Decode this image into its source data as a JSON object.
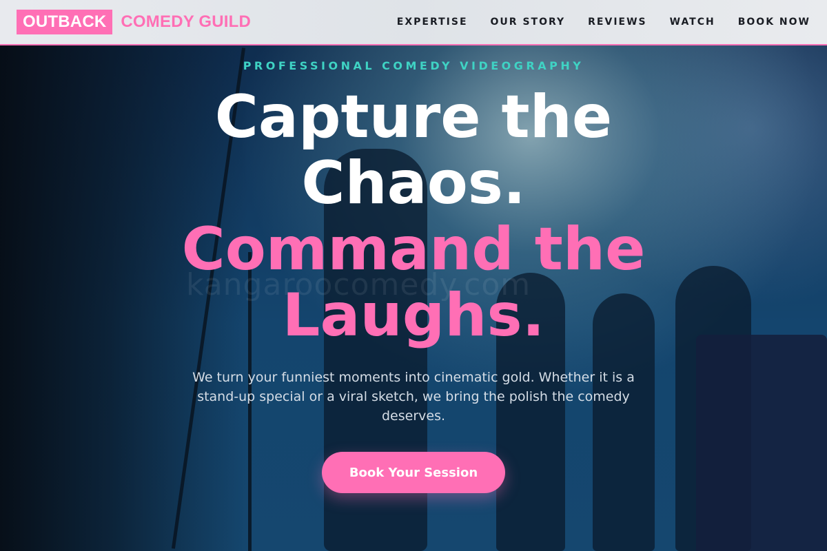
{
  "header": {
    "logo_box": "OUTBACK",
    "logo_text": "COMEDY GUILD",
    "nav": [
      "EXPERTISE",
      "OUR STORY",
      "REVIEWS",
      "WATCH",
      "BOOK NOW"
    ]
  },
  "hero": {
    "eyebrow": "PROFESSIONAL COMEDY VIDEOGRAPHY",
    "headline_line1": "Capture the",
    "headline_line2": "Chaos.",
    "headline_line3": "Command the",
    "headline_line4": "Laughs.",
    "watermark": "kangaroocomedy.com",
    "subcopy": "We turn your funniest moments into cinematic gold. Whether it is a stand-up special or a viral sketch, we bring the polish the comedy deserves.",
    "cta_label": "Book Your Session"
  },
  "colors": {
    "accent_pink": "#ff6fb5",
    "eyebrow_teal": "#3fd3c4",
    "header_bg": "#e3e6ea"
  }
}
